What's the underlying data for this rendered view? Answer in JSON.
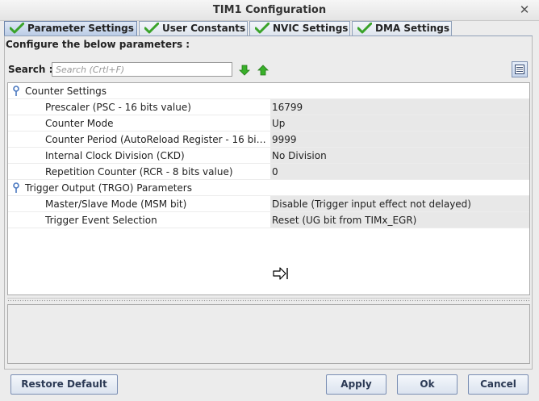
{
  "window": {
    "title": "TIM1 Configuration",
    "close_glyph": "✕"
  },
  "tabs": [
    {
      "label": "Parameter Settings",
      "active": true,
      "icon": "check-icon"
    },
    {
      "label": "User Constants",
      "active": false,
      "icon": "check-icon"
    },
    {
      "label": "NVIC Settings",
      "active": false,
      "icon": "check-icon"
    },
    {
      "label": "DMA Settings",
      "active": false,
      "icon": "check-icon"
    }
  ],
  "main": {
    "configure_label": "Configure the below parameters :",
    "search": {
      "label": "Search :",
      "value": "",
      "placeholder": "Search (Crtl+F)"
    }
  },
  "groups": [
    {
      "label": "Counter Settings",
      "params": [
        {
          "name": "Prescaler (PSC - 16 bits value)",
          "value": "16799"
        },
        {
          "name": "Counter Mode",
          "value": "Up"
        },
        {
          "name": "Counter Period (AutoReload Register - 16 bits val...",
          "value": "9999"
        },
        {
          "name": "Internal Clock Division (CKD)",
          "value": "No Division"
        },
        {
          "name": "Repetition Counter (RCR - 8 bits value)",
          "value": "0"
        }
      ]
    },
    {
      "label": "Trigger Output (TRGO) Parameters",
      "params": [
        {
          "name": "Master/Slave Mode (MSM bit)",
          "value": "Disable (Trigger input effect not delayed)"
        },
        {
          "name": "Trigger Event Selection",
          "value": "Reset (UG bit from TIMx_EGR)"
        }
      ]
    }
  ],
  "buttons": {
    "restore_default": "Restore Default",
    "apply": "Apply",
    "ok": "Ok",
    "cancel": "Cancel"
  },
  "colors": {
    "check_green": "#3aa32a",
    "arrow_green": "#39b02a",
    "pin_blue": "#4a78c0",
    "button_text": "#2c3a55"
  }
}
